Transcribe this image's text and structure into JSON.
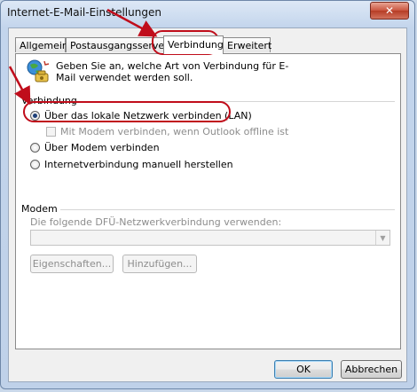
{
  "window": {
    "title": "Internet-E-Mail-Einstellungen",
    "close_glyph": "✕"
  },
  "tabs": [
    {
      "label": "Allgemein"
    },
    {
      "label": "Postausgangsserver"
    },
    {
      "label": "Verbindung"
    },
    {
      "label": "Erweitert"
    }
  ],
  "active_tab": "Verbindung",
  "intro_text": "Geben Sie an, welche Art von Verbindung für E-Mail verwendet werden soll.",
  "connection": {
    "group_label": "Verbindung",
    "options": [
      {
        "label": "Über das lokale Netzwerk verbinden (LAN)",
        "selected": true
      },
      {
        "label": "Über Modem verbinden",
        "selected": false
      },
      {
        "label": "Internetverbindung manuell herstellen",
        "selected": false
      }
    ],
    "modem_offline_checkbox": {
      "label": "Mit Modem verbinden, wenn Outlook offline ist",
      "checked": false,
      "enabled": false
    }
  },
  "modem": {
    "group_label": "Modem",
    "dialup_label": "Die folgende DFÜ-Netzwerkverbindung verwenden:",
    "dialup_value": "",
    "properties_button": "Eigenschaften...",
    "add_button": "Hinzufügen..."
  },
  "footer": {
    "ok_button": "OK",
    "cancel_button": "Abbrechen"
  },
  "colors": {
    "annotation_red": "#c00d1b",
    "selected_radio": "#1d3f78"
  },
  "icons": {
    "connection_icon": "globe-phone-icon",
    "dropdown_icon": "chevron-down-icon"
  }
}
